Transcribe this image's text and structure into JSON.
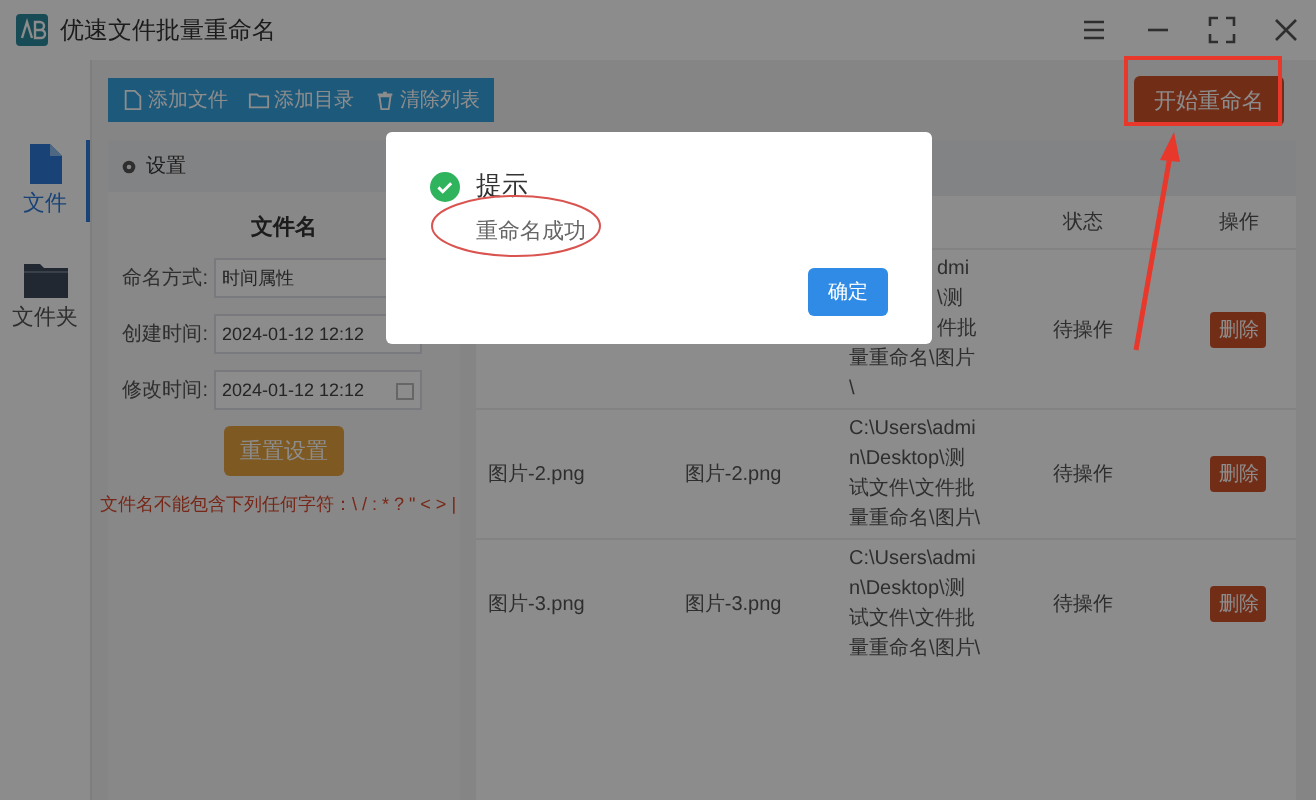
{
  "window": {
    "title": "优速文件批量重命名"
  },
  "toolbar": [
    "添加文件",
    "添加目录",
    "清除列表"
  ],
  "start_button": "开始重命名",
  "nav": [
    {
      "label": "文件",
      "selected": true
    },
    {
      "label": "文件夹",
      "selected": false
    }
  ],
  "settings": {
    "title": "设置",
    "section": "文件名",
    "fields": [
      {
        "label": "命名方式:",
        "value": "时间属性",
        "kind": "select"
      },
      {
        "label": "创建时间:",
        "value": "2024-01-12 12:12",
        "kind": "date"
      },
      {
        "label": "修改时间:",
        "value": "2024-01-12 12:12",
        "kind": "date"
      }
    ],
    "reset_button": "重置设置",
    "warning": "文件名不能包含下列任何字符：\\ / : * ? \" < > |"
  },
  "table": {
    "columns": [
      "状态",
      "操作"
    ],
    "rows": [
      {
        "path_lines": [
          "dmi",
          "\\测",
          "件批",
          "量重命名\\图片",
          "\\"
        ],
        "status": "待操作",
        "action": "删除"
      },
      {
        "name": "图片-2.png",
        "new_name": "图片-2.png",
        "path": "C:\\Users\\admin\\Desktop\\测试文件\\文件批量重命名\\图片\\",
        "status": "待操作",
        "action": "删除"
      },
      {
        "name": "图片-3.png",
        "new_name": "图片-3.png",
        "path": "C:\\Users\\admin\\Desktop\\测试文件\\文件批量重命名\\图片\\",
        "status": "待操作",
        "action": "删除"
      }
    ]
  },
  "dialog": {
    "title": "提示",
    "message": "重命名成功",
    "ok_button": "确定"
  }
}
